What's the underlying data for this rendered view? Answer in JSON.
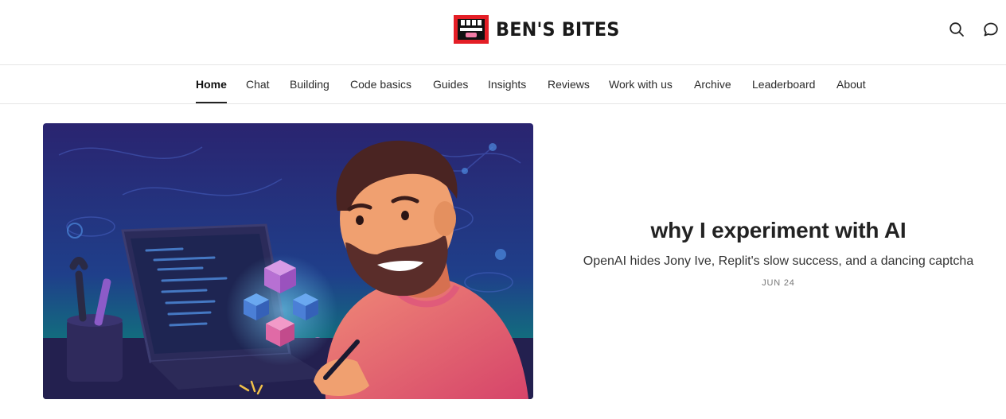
{
  "brand": {
    "name": "BEN'S BITES",
    "logo_icon": "teeth-logo-icon",
    "colors": {
      "logo_red": "#e41e26",
      "logo_black": "#111111"
    }
  },
  "header_icons": [
    "search-icon",
    "chat-bubble-icon"
  ],
  "nav": {
    "items": [
      {
        "label": "Home",
        "active": true
      },
      {
        "label": "Chat",
        "active": false
      },
      {
        "label": "Building",
        "active": false
      },
      {
        "label": "Code basics",
        "active": false
      },
      {
        "label": "Guides",
        "active": false
      },
      {
        "label": "Insights",
        "active": false
      },
      {
        "label": "Reviews",
        "active": false
      },
      {
        "label": "Work with us",
        "active": false
      },
      {
        "label": "Archive",
        "active": false
      },
      {
        "label": "Leaderboard",
        "active": false
      },
      {
        "label": "About",
        "active": false
      }
    ]
  },
  "featured_post": {
    "title": "why I experiment with AI",
    "subtitle": "OpenAI hides Jony Ive, Replit's slow success, and a dancing captcha",
    "date": "JUN 24",
    "image_icon": "illustration-man-with-laptop-icon"
  }
}
